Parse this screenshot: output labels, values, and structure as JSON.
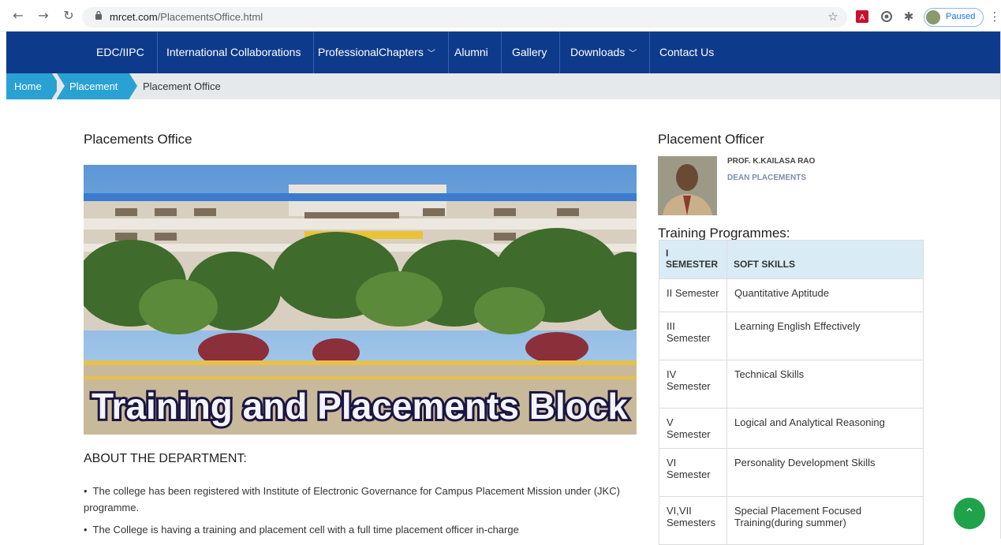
{
  "browser": {
    "url_domain": "mrcet.com",
    "url_path": "/PlacementsOffice.html",
    "paused_label": "Paused",
    "icons": [
      "back-arrow-icon",
      "forward-arrow-icon",
      "reload-icon",
      "lock-icon",
      "star-icon",
      "pdf-extension-icon",
      "circle-extension-icon",
      "puzzle-extension-icon",
      "menu-dots-icon"
    ]
  },
  "nav": {
    "items": [
      {
        "label": "EDC/IIPC",
        "dropdown": false
      },
      {
        "label": "International Collaborations",
        "dropdown": false
      },
      {
        "label": "ProfessionalChapters",
        "dropdown": true
      },
      {
        "label": "Alumni",
        "dropdown": false
      },
      {
        "label": "Gallery",
        "dropdown": false
      },
      {
        "label": "Downloads",
        "dropdown": true
      },
      {
        "label": "Contact Us",
        "dropdown": false
      }
    ],
    "color": "#0e3a8c"
  },
  "breadcrumb": {
    "home": "Home",
    "placement": "Placement",
    "current": "Placement Office",
    "accent": "#2aa1d3"
  },
  "main": {
    "title": "Placements Office",
    "hero_caption": "Training and Placements Block",
    "about_heading": "ABOUT THE DEPARTMENT:",
    "bullets": [
      "The college has been registered with Institute of Electronic Governance for Campus Placement Mission under (JKC) programme.",
      "The College is having a training and placement cell with a full time placement officer in-charge"
    ]
  },
  "sidebar": {
    "officer_heading": "Placement Officer",
    "officer_name": "PROF. K.KAILASA RAO",
    "officer_role": "DEAN PLACEMENTS",
    "training_heading": "Training Programmes:",
    "table": {
      "headers": [
        "I SEMESTER",
        "SOFT SKILLS"
      ],
      "rows": [
        [
          "II Semester",
          "Quantitative Aptitude"
        ],
        [
          "III Semester",
          "Learning English Effectively"
        ],
        [
          "IV Semester",
          "Technical Skills"
        ],
        [
          "V Semester",
          "Logical and Analytical Reasoning"
        ],
        [
          "VI Semester",
          "Personality Development Skills"
        ],
        [
          "VI,VII Semesters",
          "Special Placement Focused Training(during summer)"
        ]
      ]
    }
  },
  "scroll_top_icon": "chevron-up-icon",
  "accent_green": "#1fa24a"
}
